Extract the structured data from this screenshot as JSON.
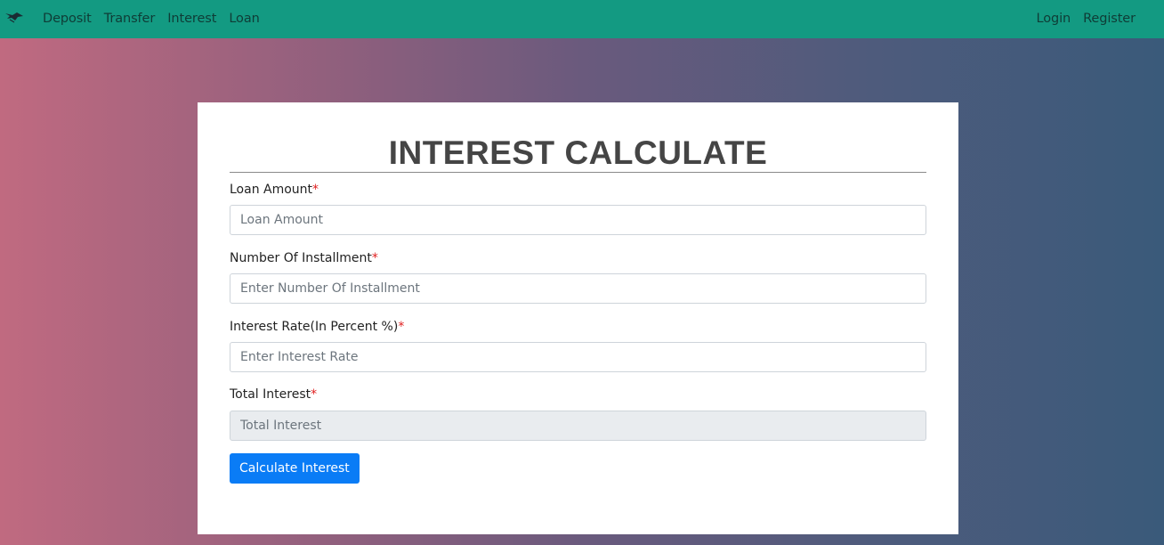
{
  "navbar": {
    "brand_icon": "bird-logo-icon",
    "left_links": [
      "Deposit",
      "Transfer",
      "Interest",
      "Loan"
    ],
    "right_links": [
      "Login",
      "Register"
    ],
    "color": "#139a82"
  },
  "form": {
    "title": "INTEREST CALCULATE",
    "required_mark": "*",
    "fields": [
      {
        "label": "Loan Amount",
        "placeholder": "Loan Amount"
      },
      {
        "label": "Number Of Installment",
        "placeholder": "Enter Number Of Installment"
      },
      {
        "label": "Interest Rate(In Percent %)",
        "placeholder": "Enter Interest Rate"
      },
      {
        "label": "Total Interest",
        "placeholder": "Total Interest"
      }
    ],
    "submit_label": "Calculate Interest",
    "button_color": "#0a7cf6"
  }
}
